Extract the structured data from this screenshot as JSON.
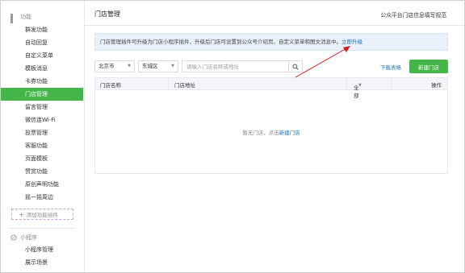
{
  "sidebar": {
    "section1": {
      "title": "功能",
      "icon": "grid-icon"
    },
    "items": [
      {
        "label": "群发功能"
      },
      {
        "label": "自动回复"
      },
      {
        "label": "自定义菜单"
      },
      {
        "label": "模板消息"
      },
      {
        "label": "卡券功能"
      },
      {
        "label": "门店管理",
        "active": true
      },
      {
        "label": "留言管理"
      },
      {
        "label": "微信连Wi-Fi"
      },
      {
        "label": "投票管理"
      },
      {
        "label": "客服功能"
      },
      {
        "label": "页面模板"
      },
      {
        "label": "赞赏功能"
      },
      {
        "label": "原创声明功能"
      },
      {
        "label": "摇一摇周边"
      }
    ],
    "add_plugin": "添加功能插件",
    "section2": {
      "title": "小程序",
      "icon": "mini-program-icon"
    },
    "items2": [
      {
        "label": "小程序管理"
      },
      {
        "label": "展示场景"
      }
    ]
  },
  "header": {
    "title": "门店管理",
    "guide_link": "公众平台门店信息填写规范"
  },
  "notice": {
    "text": "门店管理插件可升级为门店小程序插件，升级后门店可设置到公众号介绍页、自定义菜单和图文消息中。",
    "link": "立即升级"
  },
  "filters": {
    "city": "北京市",
    "district": "东城区",
    "search_placeholder": "请输入门店名称或地址"
  },
  "actions": {
    "download": "下载表格",
    "new_store": "新建门店"
  },
  "table": {
    "columns": [
      "门店名称",
      "门店地址",
      "全部",
      "操作"
    ],
    "empty_text": "暂无门店，点击",
    "empty_link": "新建门店"
  },
  "colors": {
    "accent_green": "#44b549",
    "link_blue": "#1e73be",
    "notice_bg": "#e8f0f9",
    "arrow_red": "#d7191c"
  }
}
